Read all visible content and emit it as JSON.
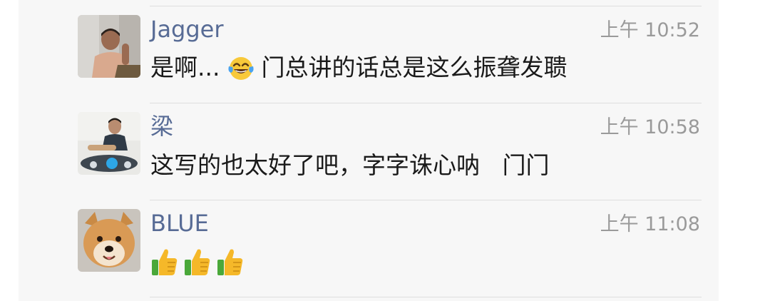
{
  "messages": [
    {
      "name": "Jagger",
      "time": "上午 10:52",
      "text_before_emoji": "是啊...",
      "emoji": "laughing-with-tears",
      "text_after_emoji": "门总讲的话总是这么振聋发聩"
    },
    {
      "name": "梁",
      "time": "上午 10:58",
      "text": "这写的也太好了吧，字字诛心呐   门门"
    },
    {
      "name": "BLUE",
      "time": "上午 11:08",
      "emojis": [
        "thumbs-up",
        "thumbs-up",
        "thumbs-up"
      ]
    }
  ],
  "colors": {
    "name": "#576b95",
    "time": "#9a9a9a",
    "text": "#1a1a1a",
    "panel": "#f7f7f7",
    "divider": "#dedede"
  }
}
